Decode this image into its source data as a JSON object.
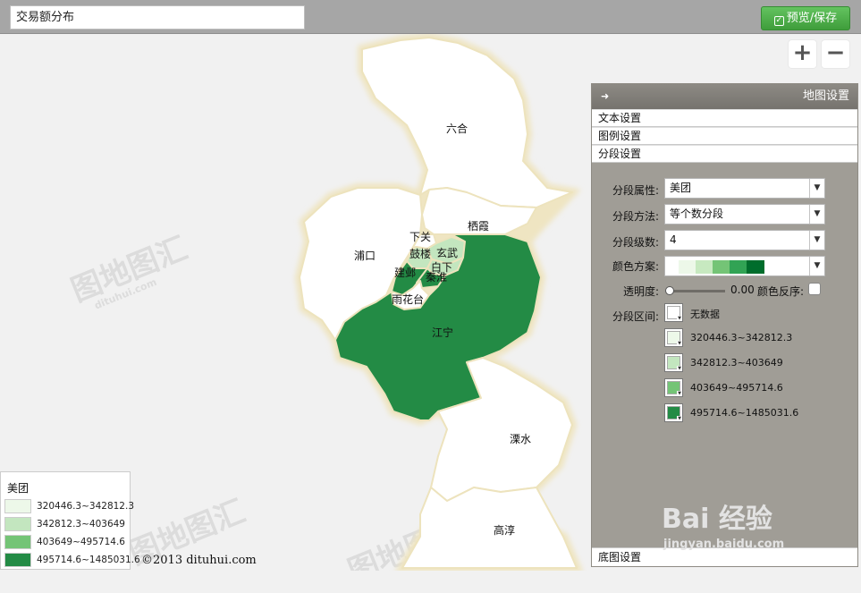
{
  "header": {
    "title": "交易额分布",
    "preview_button": "预览/保存"
  },
  "zoom": {
    "in": "+",
    "out": "−"
  },
  "map": {
    "districts": [
      {
        "name": "六合",
        "color": "#ffffff"
      },
      {
        "name": "栖霞",
        "color": "#ffffff"
      },
      {
        "name": "浦口",
        "color": "#ffffff"
      },
      {
        "name": "下关",
        "color": "#ffffff"
      },
      {
        "name": "鼓楼",
        "color": "#c3e6bf"
      },
      {
        "name": "玄武",
        "color": "#c3e6bf"
      },
      {
        "name": "白下",
        "color": "#c3e6bf"
      },
      {
        "name": "建邺",
        "color": "#238b45"
      },
      {
        "name": "秦淮",
        "color": "#238b45"
      },
      {
        "name": "雨花台",
        "color": "#ffffff"
      },
      {
        "name": "江宁",
        "color": "#238b45"
      },
      {
        "name": "溧水",
        "color": "#ffffff"
      },
      {
        "name": "高淳",
        "color": "#ffffff"
      }
    ],
    "watermark": "图地图汇",
    "watermark_sub": "dituhui.com"
  },
  "panel": {
    "title": "地图设置",
    "tabs": [
      "文本设置",
      "图例设置",
      "分段设置"
    ],
    "segment": {
      "attribute_label": "分段属性:",
      "attribute_value": "美团",
      "method_label": "分段方法:",
      "method_value": "等个数分段",
      "levels_label": "分段级数:",
      "levels_value": "4",
      "color_scheme_label": "颜色方案:",
      "color_scheme": [
        "#edf8e9",
        "#c7e9c0",
        "#74c476",
        "#31a354",
        "#006d2c"
      ],
      "opacity_label": "透明度:",
      "opacity_value": "0.00",
      "reverse_label": "颜色反序:",
      "ranges_label": "分段区间:",
      "ranges": [
        {
          "label": "无数据",
          "color": "#ffffff"
        },
        {
          "label": "320446.3~342812.3",
          "color": "#edf8e9"
        },
        {
          "label": "342812.3~403649",
          "color": "#c3e6bf"
        },
        {
          "label": "403649~495714.6",
          "color": "#74c476"
        },
        {
          "label": "495714.6~1485031.6",
          "color": "#238b45"
        }
      ]
    },
    "basemap_tab": "底图设置"
  },
  "legend": {
    "title": "美团",
    "items": [
      {
        "label": "320446.3~342812.3",
        "color": "#edf8e9"
      },
      {
        "label": "342812.3~403649",
        "color": "#c3e6bf"
      },
      {
        "label": "403649~495714.6",
        "color": "#74c476"
      },
      {
        "label": "495714.6~1485031.6",
        "color": "#238b45"
      }
    ]
  },
  "copyright": "©2013 dituhui.com",
  "baidu_watermark": "Bai 经验",
  "baidu_url": "jingyan.baidu.com"
}
